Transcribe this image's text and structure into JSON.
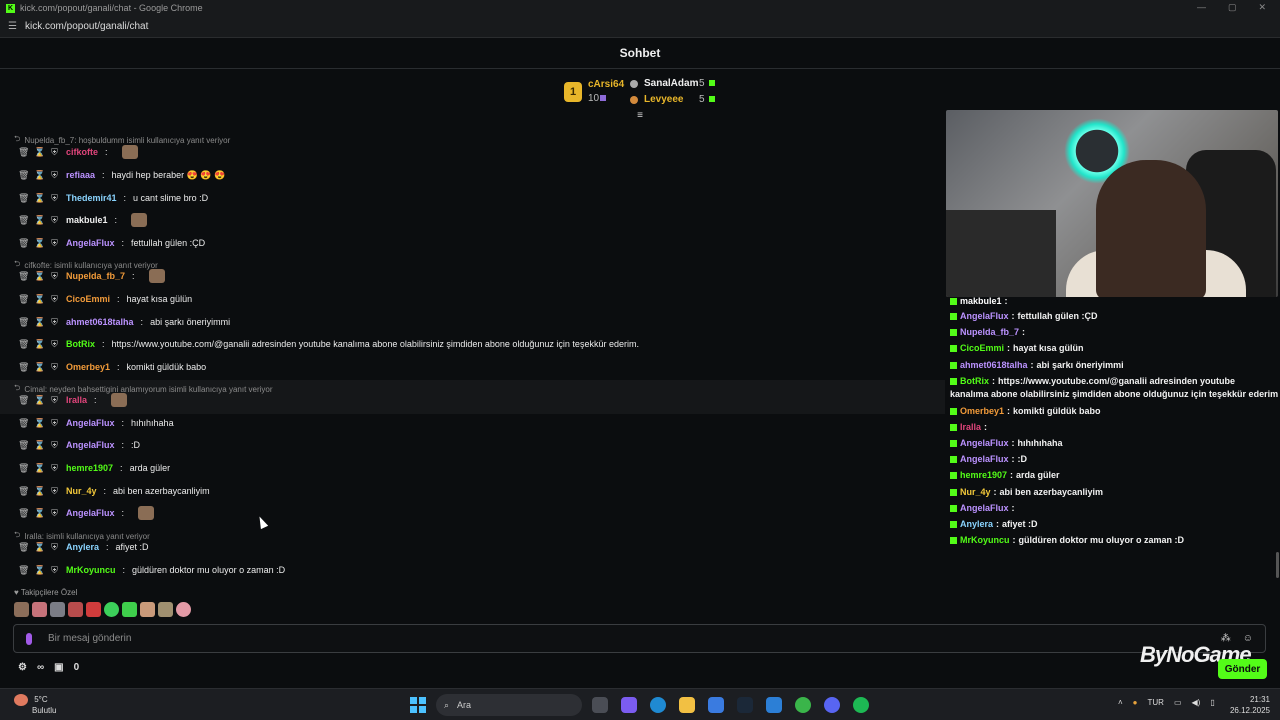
{
  "browser": {
    "window_title": "kick.com/popout/ganali/chat - Google Chrome",
    "url": "kick.com/popout/ganali/chat"
  },
  "header": {
    "title": "Sohbet"
  },
  "leaderboard": {
    "first": {
      "name": "cArsi64",
      "value": "10",
      "rank": "1"
    },
    "second": {
      "name": "SanalAdam",
      "value": "5"
    },
    "third": {
      "name": "Levyeee",
      "value": "5"
    }
  },
  "chat": {
    "messages": [
      {
        "reply": "Nupelda_fb_7: hoşbuldumm isimli kullanıcıya yanıt veriyor"
      },
      {
        "user": "cifkofte",
        "color": "#e0457b",
        "text": ""
      },
      {
        "user": "refiaaa",
        "color": "#bb92ff",
        "text": "haydi hep beraber 😍 😍 😍"
      },
      {
        "user": "Thedemir41",
        "color": "#8ad4ff",
        "text": "u cant slime bro :D"
      },
      {
        "user": "makbule1",
        "color": "#f0f0f0",
        "text": ""
      },
      {
        "user": "AngelaFlux",
        "color": "#bb92ff",
        "text": "fettullah gülen :ÇD"
      },
      {
        "reply": "cifkofte: isimli kullanıcıya yanıt veriyor"
      },
      {
        "user": "Nupelda_fb_7",
        "color": "#f29b3a",
        "text": ""
      },
      {
        "user": "CicoEmmi",
        "color": "#f29b3a",
        "text": "hayat kısa gülün"
      },
      {
        "user": "ahmet0618talha",
        "color": "#bb92ff",
        "text": "abi şarkı öneriyimmi"
      },
      {
        "user": "BotRix",
        "color": "#53fc18",
        "text": "https://www.youtube.com/@ganalii adresinden youtube kanalıma abone olabilirsiniz şimdiden abone olduğunuz için teşekkür ederim."
      },
      {
        "user": "Omerbey1",
        "color": "#f29b3a",
        "text": "komikti güldük babo"
      },
      {
        "reply": "Cimal: neyden bahsettigini anlamıyorum isimli kullanıcıya yanıt veriyor"
      },
      {
        "user": "Iralla",
        "color": "#e0457b",
        "text": ""
      },
      {
        "user": "AngelaFlux",
        "color": "#bb92ff",
        "text": "hıhıhıhaha"
      },
      {
        "user": "AngelaFlux",
        "color": "#bb92ff",
        "text": ":D"
      },
      {
        "user": "hemre1907",
        "color": "#53fc18",
        "text": "arda güler"
      },
      {
        "user": "Nur_4y",
        "color": "#f2c83a",
        "text": "abi ben azerbaycanliyim"
      },
      {
        "user": "AngelaFlux",
        "color": "#bb92ff",
        "text": ""
      },
      {
        "reply": "Iralla: isimli kullanıcıya yanıt veriyor"
      },
      {
        "user": "Anylera",
        "color": "#8ad4ff",
        "text": "afiyet :D"
      },
      {
        "user": "MrKoyuncu",
        "color": "#53fc18",
        "text": "güldüren doktor mu oluyor o zaman :D"
      }
    ]
  },
  "overlay": {
    "lines": [
      {
        "user": "makbule1",
        "text": ""
      },
      {
        "user": "AngelaFlux",
        "text": "fettullah gülen :ÇD"
      },
      {
        "user": "Nupelda_fb_7",
        "text": ""
      },
      {
        "user": "CicoEmmi",
        "text": "hayat kısa gülün"
      },
      {
        "user": "ahmet0618talha",
        "text": "abi şarkı öneriyimmi"
      },
      {
        "user": "BotRix",
        "text": "https://www.youtube.com/@ganalii adresinden youtube"
      },
      {
        "user": "",
        "text": "kanalıma abone olabilirsiniz şimdiden abone olduğunuz için teşekkür ederim."
      },
      {
        "user": "Omerbey1",
        "text": "komikti güldük babo"
      },
      {
        "user": "Iralla",
        "text": ""
      },
      {
        "user": "AngelaFlux",
        "text": "hıhıhıhaha"
      },
      {
        "user": "AngelaFlux",
        "text": ":D"
      },
      {
        "user": "hemre1907",
        "text": "arda güler"
      },
      {
        "user": "Nur_4y",
        "text": "abi ben azerbaycanliyim"
      },
      {
        "user": "AngelaFlux",
        "text": ""
      },
      {
        "user": "Anylera",
        "text": "afiyet :D"
      },
      {
        "user": "MrKoyuncu",
        "text": "güldüren doktor mu oluyor o zaman :D"
      }
    ],
    "colors": [
      "#ffffff",
      "#bb92ff",
      "#bb92ff",
      "#53fc18",
      "#bb92ff",
      "#53fc18",
      "#ffffff",
      "#f29b3a",
      "#e0457b",
      "#bb92ff",
      "#bb92ff",
      "#53fc18",
      "#f2c83a",
      "#bb92ff",
      "#8ad4ff",
      "#53fc18"
    ]
  },
  "followers_label": "Takipçilere Özel",
  "input": {
    "placeholder": "Bir mesaj gönderin"
  },
  "bottom": {
    "count": "0"
  },
  "send_label": "Gönder",
  "logo_text": "ByNoGame",
  "taskbar": {
    "weather_temp": "5°C",
    "weather_desc": "Bulutlu",
    "search_label": "Ara",
    "lang": "TUR",
    "time": "21:31",
    "date": "26.12.2025"
  }
}
